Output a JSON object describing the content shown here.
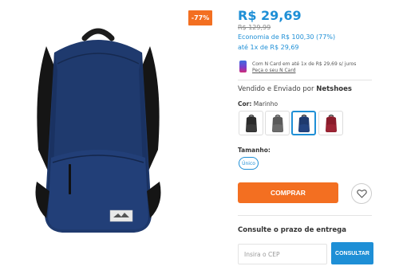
{
  "product": {
    "discount_badge": "-77%",
    "price": "R$ 29,69",
    "old_price": "R$ 129,99",
    "economy": "Economia de R$ 100,30 (77%)",
    "installments": "até 1x de R$ 29,69"
  },
  "ncard": {
    "text": "Com N Card em até 1x de R$ 29,69 s/ juros",
    "link": "Peça o seu N Card"
  },
  "seller": {
    "prefix": "Vendido e Enviado por",
    "name": "Netshoes"
  },
  "color": {
    "label": "Cor:",
    "selected": "Marinho",
    "swatches": [
      {
        "name": "black",
        "color": "#2b2b2b"
      },
      {
        "name": "gray",
        "color": "#5a5a5a"
      },
      {
        "name": "navy",
        "color": "#1f3a6e"
      },
      {
        "name": "burgundy",
        "color": "#8a1c2b"
      }
    ],
    "selected_index": 2
  },
  "size": {
    "label": "Tamanho:",
    "option": "Único"
  },
  "buy": {
    "label": "COMPRAR"
  },
  "shipping": {
    "title": "Consulte o prazo de entrega",
    "placeholder": "Insira o CEP",
    "button": "CONSULTAR"
  },
  "colors": {
    "accent_blue": "#1e8fd6",
    "accent_orange": "#f36f21"
  }
}
